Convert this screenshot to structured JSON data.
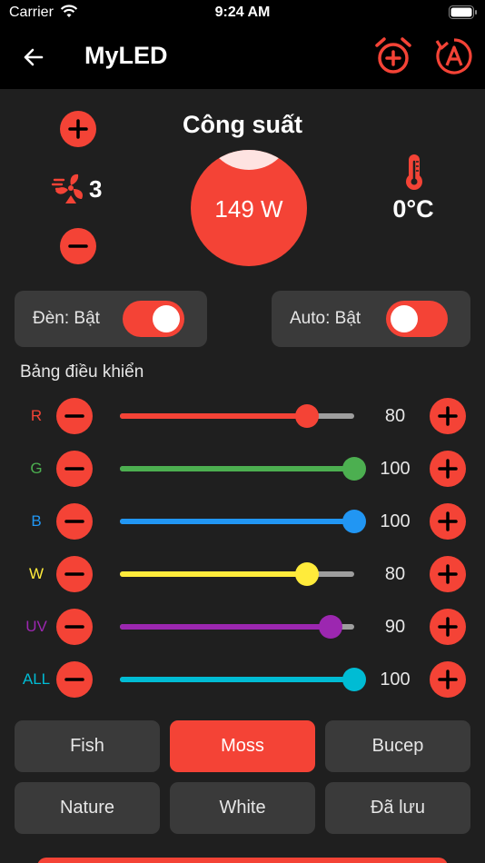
{
  "status": {
    "carrier": "Carrier",
    "time": "9:24 AM"
  },
  "header": {
    "title": "MyLED",
    "back_icon": "arrow-left-icon",
    "alarm_icon": "alarm-add-icon",
    "auto_icon": "auto-mode-icon"
  },
  "fan": {
    "icon": "fan-icon",
    "value": "3"
  },
  "power": {
    "title": "Công suất",
    "value": "149 W"
  },
  "temperature": {
    "icon": "thermometer-icon",
    "value": "0°C"
  },
  "toggles": {
    "lamp": {
      "label": "Đèn: Bật",
      "on": true
    },
    "auto": {
      "label": "Auto: Bật",
      "on": true
    }
  },
  "control_panel": {
    "title": "Bảng điều khiển",
    "channels": [
      {
        "label": "R",
        "value": "80",
        "level": 0.8,
        "color": "#f44336"
      },
      {
        "label": "G",
        "value": "100",
        "level": 1.0,
        "color": "#4caf50"
      },
      {
        "label": "B",
        "value": "100",
        "level": 1.0,
        "color": "#2196f3"
      },
      {
        "label": "W",
        "value": "80",
        "level": 0.8,
        "color": "#ffeb3b"
      },
      {
        "label": "UV",
        "value": "90",
        "level": 0.9,
        "color": "#9c27b0"
      },
      {
        "label": "ALL",
        "value": "100",
        "level": 1.0,
        "color": "#00bcd4"
      }
    ]
  },
  "presets": [
    {
      "label": "Fish",
      "active": false
    },
    {
      "label": "Moss",
      "active": true
    },
    {
      "label": "Bucep",
      "active": false
    },
    {
      "label": "Nature",
      "active": false
    },
    {
      "label": "White",
      "active": false
    },
    {
      "label": "Đã lưu",
      "active": false
    }
  ],
  "colors": {
    "accent": "#f44336",
    "background": "#1f1f1f",
    "card": "#3a3a3a"
  }
}
